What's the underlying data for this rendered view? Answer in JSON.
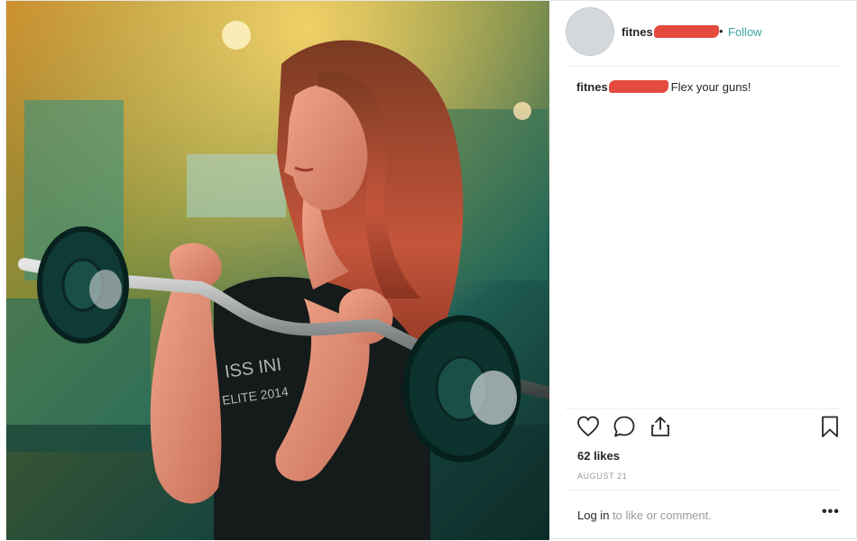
{
  "header": {
    "username": "fitnes",
    "separator": "•",
    "follow_label": "Follow"
  },
  "caption": {
    "username": "fitnes",
    "text": "Flex your guns!"
  },
  "actions": {
    "icons": [
      "heart-icon",
      "comment-icon",
      "share-icon",
      "bookmark-icon"
    ]
  },
  "stats": {
    "likes": "62 likes",
    "date": "AUGUST 21"
  },
  "footer": {
    "login_link": "Log in",
    "login_rest": " to like or comment.",
    "more_label": "•••"
  },
  "colors": {
    "accent": "#3ca3a0",
    "redaction": "#e44a3e"
  }
}
